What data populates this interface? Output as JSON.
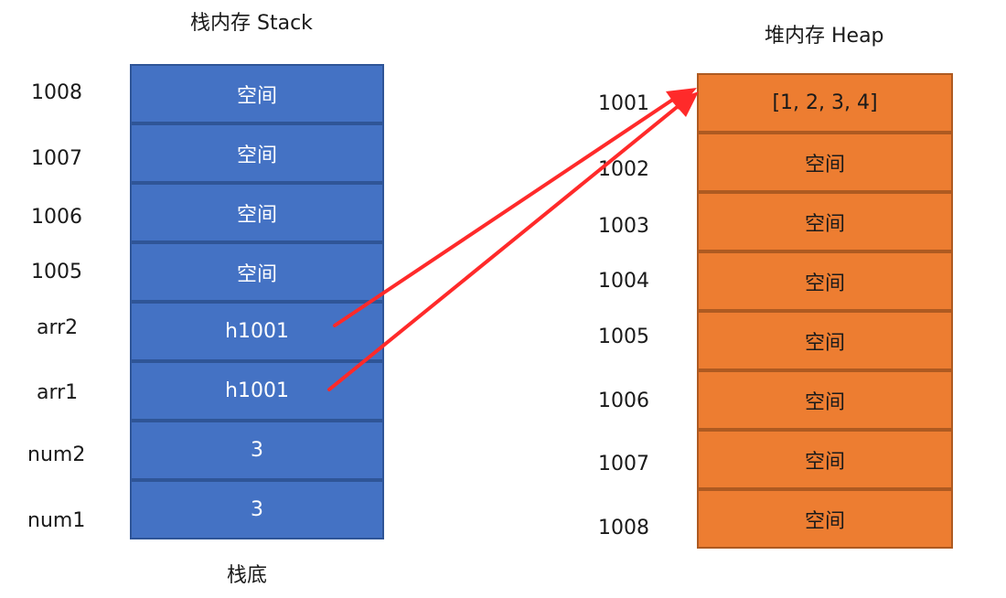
{
  "stack": {
    "title": "栈内存 Stack",
    "footer": "栈底",
    "rows": [
      {
        "label": "1008",
        "value": "空间"
      },
      {
        "label": "1007",
        "value": "空间"
      },
      {
        "label": "1006",
        "value": "空间"
      },
      {
        "label": "1005",
        "value": "空间"
      },
      {
        "label": "arr2",
        "value": "h1001"
      },
      {
        "label": "arr1",
        "value": "h1001"
      },
      {
        "label": "num2",
        "value": "3"
      },
      {
        "label": "num1",
        "value": "3"
      }
    ]
  },
  "heap": {
    "title": "堆内存 Heap",
    "rows": [
      {
        "label": "1001",
        "value": "[1, 2, 3, 4]"
      },
      {
        "label": "1002",
        "value": "空间"
      },
      {
        "label": "1003",
        "value": "空间"
      },
      {
        "label": "1004",
        "value": "空间"
      },
      {
        "label": "1005",
        "value": "空间"
      },
      {
        "label": "1006",
        "value": "空间"
      },
      {
        "label": "1007",
        "value": "空间"
      },
      {
        "label": "1008",
        "value": "空间"
      }
    ]
  },
  "colors": {
    "stack_fill": "#4472c4",
    "stack_border": "#2f5597",
    "heap_fill": "#ed7d31",
    "heap_border": "#ae5a21",
    "arrow": "#ff2a2a"
  }
}
